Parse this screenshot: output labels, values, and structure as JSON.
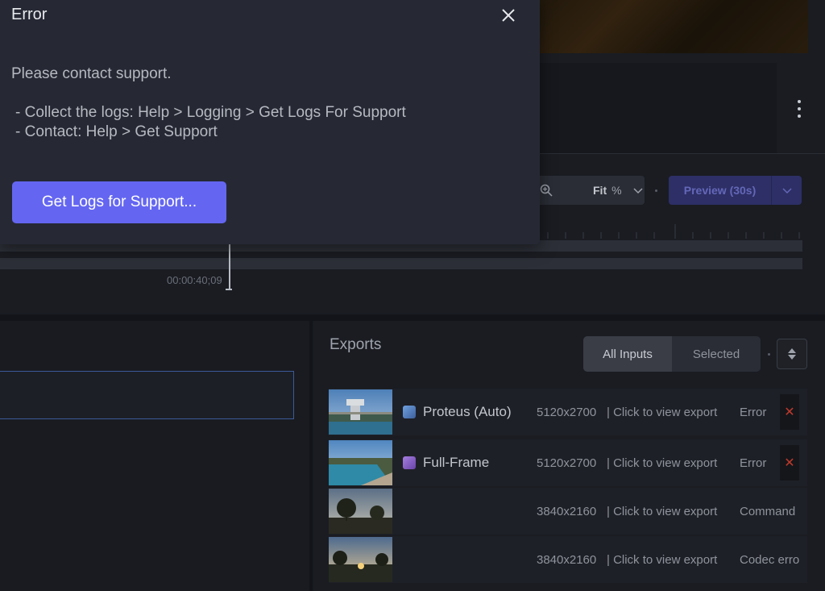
{
  "dialog": {
    "title": "Error",
    "message": "Please contact support.",
    "lines": [
      "- Collect the logs: Help > Logging > Get Logs For Support",
      "- Contact: Help > Get Support"
    ],
    "primary_button": "Get Logs for Support..."
  },
  "toolbar": {
    "zoom_value": "Fit",
    "zoom_unit": "%",
    "preview_label": "Preview (30s)"
  },
  "timeline": {
    "timecode": "00:00:40;09"
  },
  "exports": {
    "title": "Exports",
    "filter_tabs": [
      "All Inputs",
      "Selected"
    ],
    "active_tab": "All Inputs",
    "rows": [
      {
        "name": "Proteus (Auto)",
        "resolution": "5120x2700",
        "link": "| Click to view export",
        "status": "Error",
        "icon_color": "#5b86c9",
        "thumb": "water-tower"
      },
      {
        "name": "Full-Frame",
        "resolution": "5120x2700",
        "link": "| Click to view export",
        "status": "Error",
        "icon_color": "#8a5cc7",
        "thumb": "pool"
      },
      {
        "name": "",
        "resolution": "3840x2160",
        "link": "| Click to view export",
        "status": "Command",
        "icon_color": "",
        "thumb": "forest"
      },
      {
        "name": "",
        "resolution": "3840x2160",
        "link": "| Click to view export",
        "status": "Codec erro",
        "icon_color": "",
        "thumb": "sunset"
      }
    ]
  },
  "colors": {
    "accent": "#6466f1",
    "dialog_bg": "#262934",
    "error_x": "#c0392b"
  }
}
